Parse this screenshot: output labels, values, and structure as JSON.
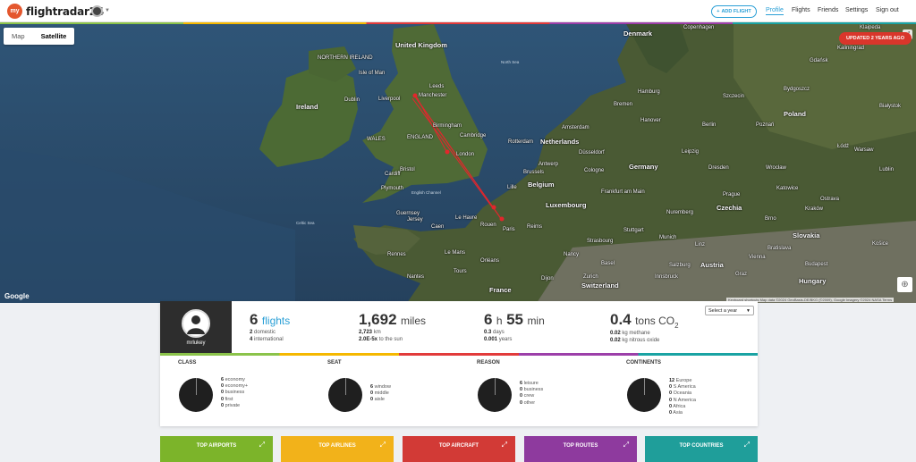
{
  "header": {
    "logo_text": "flightradar24",
    "logo_badge": "my",
    "add_flight_label": "ADD FLIGHT",
    "nav": [
      "Profile",
      "Flights",
      "Friends",
      "Settings",
      "Sign out"
    ],
    "active_nav": "Profile",
    "accent_color": "#2a9fd6"
  },
  "map": {
    "toggle": [
      "Map",
      "Satellite"
    ],
    "active_toggle": "Satellite",
    "updated_badge": "UPDATED 2 YEARS AGO",
    "google_label": "Google",
    "attribution": "Keyboard shortcuts   Map data ©2024 GeoBasis-DE/BKG (©2009), Google Imagery ©2024 NASA   Terms",
    "route_color": "#e3262c",
    "labels": {
      "countries": [
        "United Kingdom",
        "NORTHERN IRELAND",
        "Ireland",
        "WALES",
        "ENGLAND",
        "Netherlands",
        "Belgium",
        "Luxembourg",
        "Germany",
        "Czechia",
        "Austria",
        "Slovakia",
        "Hungary",
        "Switzerland",
        "France",
        "Poland",
        "Denmark",
        "Guernsey",
        "Jersey"
      ],
      "cities": [
        "Isle of Man",
        "Leeds",
        "Manchester",
        "Liverpool",
        "Birmingham",
        "London",
        "Dublin",
        "Paris",
        "Amsterdam",
        "Rotterdam",
        "Brussels",
        "Frankfurt am Main",
        "Munich",
        "Prague",
        "Berlin",
        "Hamburg",
        "Copenhagen",
        "Warsaw",
        "Vienna",
        "Bratislava",
        "Budapest",
        "Zurich",
        "Stuttgart",
        "Nuremberg",
        "Leipzig",
        "Dresden",
        "Hanover",
        "Bremen",
        "Düsseldorf",
        "Cologne",
        "Antwerp",
        "Lille",
        "Gdańsk",
        "Szczecin",
        "Wrocław",
        "Łódź",
        "Kraków",
        "Katowice",
        "Poznań",
        "Bydgoszcz",
        "Lublin",
        "Białystok",
        "Klaipeda",
        "Kaliningrad",
        "Cardiff",
        "Cambridge",
        "Bristol",
        "Plymouth",
        "Brno",
        "Ostrava",
        "Košice",
        "Linz",
        "Graz",
        "Salzburg",
        "Innsbruck",
        "Strasbourg",
        "Basel",
        "Rennes",
        "Nantes",
        "Le Havre",
        "Caen",
        "Rouen",
        "Reims",
        "Nancy",
        "Dijon",
        "Orléans",
        "Tours",
        "Le Mans"
      ],
      "seas": [
        "English Channel",
        "Celtic Sea",
        "North Sea"
      ]
    }
  },
  "profile": {
    "username": "mrlukey",
    "year_select": "Select a year"
  },
  "stats": {
    "flights": {
      "value": "6",
      "unit": "flights",
      "domestic": "2",
      "domestic_label": "domestic",
      "international": "4",
      "international_label": "international"
    },
    "distance": {
      "value": "1,692",
      "unit": "miles",
      "km": "2,723",
      "km_label": "km",
      "sun": "2.0E-5x",
      "sun_label": "to the sun"
    },
    "time": {
      "hours": "6",
      "h_label": "h",
      "minutes": "55",
      "min_label": "min",
      "days": "0.3",
      "days_label": "days",
      "years": "0.001",
      "years_label": "years"
    },
    "co2": {
      "value": "0.4",
      "unit": "tons CO",
      "unit_sub": "2",
      "methane": "0.02",
      "methane_label": "kg methane",
      "nitrous": "0.02",
      "nitrous_label": "kg nitrous oxide"
    }
  },
  "breakdowns": [
    {
      "title": "CLASS",
      "rows": [
        {
          "n": "6",
          "label": "economy"
        },
        {
          "n": "0",
          "label": "economy+"
        },
        {
          "n": "0",
          "label": "business"
        },
        {
          "n": "0",
          "label": "first"
        },
        {
          "n": "0",
          "label": "private"
        }
      ]
    },
    {
      "title": "SEAT",
      "rows": [
        {
          "n": "6",
          "label": "window"
        },
        {
          "n": "0",
          "label": "middle"
        },
        {
          "n": "0",
          "label": "aisle"
        }
      ]
    },
    {
      "title": "REASON",
      "rows": [
        {
          "n": "6",
          "label": "leisure"
        },
        {
          "n": "0",
          "label": "business"
        },
        {
          "n": "0",
          "label": "crew"
        },
        {
          "n": "0",
          "label": "other"
        }
      ]
    },
    {
      "title": "CONTINENTS",
      "rows": [
        {
          "n": "12",
          "label": "Europe"
        },
        {
          "n": "0",
          "label": "S America"
        },
        {
          "n": "0",
          "label": "Oceania"
        },
        {
          "n": "0",
          "label": "N America"
        },
        {
          "n": "0",
          "label": "Africa"
        },
        {
          "n": "0",
          "label": "Asia"
        }
      ]
    }
  ],
  "tiles": [
    {
      "label": "TOP AIRPORTS",
      "color": "#7cb42a"
    },
    {
      "label": "TOP AIRLINES",
      "color": "#f2b21a"
    },
    {
      "label": "TOP AIRCRAFT",
      "color": "#d23a36"
    },
    {
      "label": "TOP ROUTES",
      "color": "#8e3a9e"
    },
    {
      "label": "TOP COUNTRIES",
      "color": "#1f9e9a"
    }
  ]
}
